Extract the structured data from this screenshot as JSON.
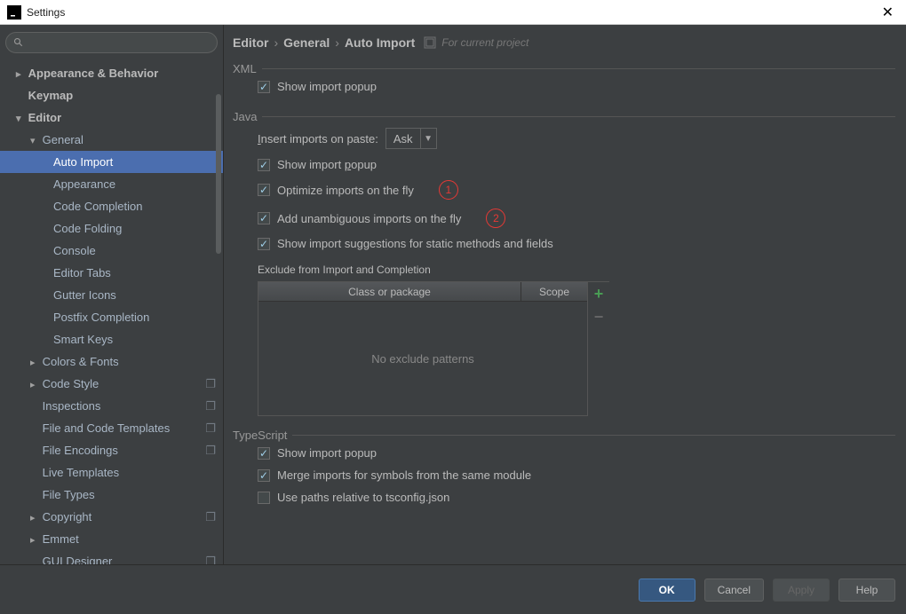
{
  "window": {
    "title": "Settings"
  },
  "search": {
    "placeholder": ""
  },
  "tree": {
    "items": [
      {
        "label": "Appearance & Behavior"
      },
      {
        "label": "Keymap"
      },
      {
        "label": "Editor"
      },
      {
        "label": "General"
      },
      {
        "label": "Auto Import"
      },
      {
        "label": "Appearance"
      },
      {
        "label": "Code Completion"
      },
      {
        "label": "Code Folding"
      },
      {
        "label": "Console"
      },
      {
        "label": "Editor Tabs"
      },
      {
        "label": "Gutter Icons"
      },
      {
        "label": "Postfix Completion"
      },
      {
        "label": "Smart Keys"
      },
      {
        "label": "Colors & Fonts"
      },
      {
        "label": "Code Style"
      },
      {
        "label": "Inspections"
      },
      {
        "label": "File and Code Templates"
      },
      {
        "label": "File Encodings"
      },
      {
        "label": "Live Templates"
      },
      {
        "label": "File Types"
      },
      {
        "label": "Copyright"
      },
      {
        "label": "Emmet"
      },
      {
        "label": "GUI Designer"
      }
    ]
  },
  "breadcrumb": {
    "a": "Editor",
    "b": "General",
    "c": "Auto Import",
    "note": "For current project"
  },
  "sections": {
    "xml": {
      "legend": "XML",
      "show_popup": "Show import popup"
    },
    "java": {
      "legend": "Java",
      "insert_label_pre": "I",
      "insert_label_rest": "nsert imports on paste:",
      "insert_value": "Ask",
      "show_popup_pre": "Show import ",
      "show_popup_u": "p",
      "show_popup_post": "opup",
      "optimize": "Optimize imports on the fly",
      "unambiguous": "Add unambiguous imports on the fly",
      "suggestions": "Show import suggestions for static methods and fields",
      "exclude_label": "Exclude from Import and Completion",
      "col1": "Class or package",
      "col2": "Scope",
      "empty": "No exclude patterns",
      "annot1": "1",
      "annot2": "2"
    },
    "ts": {
      "legend": "TypeScript",
      "show_popup": "Show import popup",
      "merge": "Merge imports for symbols  from the same module",
      "paths": "Use paths relative to tsconfig.json"
    }
  },
  "footer": {
    "ok": "OK",
    "cancel": "Cancel",
    "apply": "Apply",
    "help": "Help"
  }
}
